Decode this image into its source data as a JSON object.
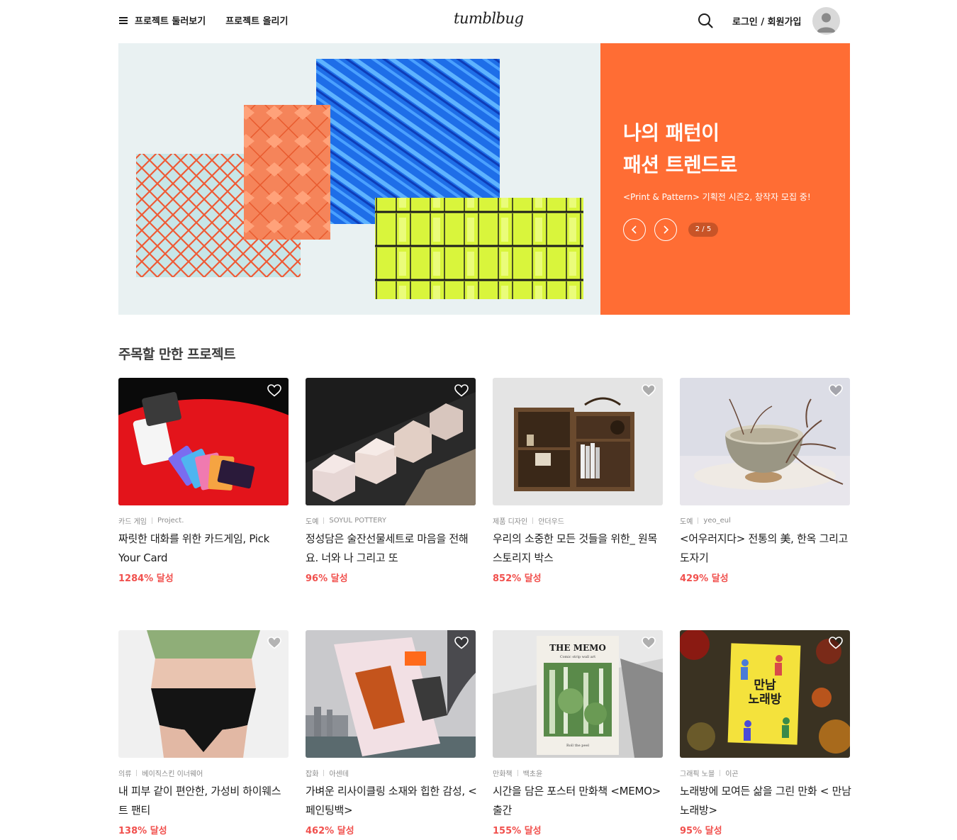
{
  "header": {
    "browse_label": "프로젝트 둘러보기",
    "upload_label": "프로젝트 올리기",
    "logo": "tumblbug",
    "login_label": "로그인 / 회원가입"
  },
  "banner": {
    "title_line1": "나의 패턴이",
    "title_line2": "패션 트렌드로",
    "subtitle": "<Print & Pattern> 기획전 시즌2, 창작자 모집 중!",
    "pager": "2 / 5",
    "panel_color": "#ff6d34"
  },
  "section": {
    "title": "주목할 만한 프로젝트"
  },
  "projects": [
    {
      "category": "카드 게임",
      "creator": "Project.",
      "title": "짜릿한 대화를 위한 카드게임, Pick Your Card",
      "percent": "1284% 달성"
    },
    {
      "category": "도예",
      "creator": "SOYUL POTTERY",
      "title": "정성담은 술잔선물세트로 마음을 전해요. 너와 나 그리고 또",
      "percent": "96% 달성"
    },
    {
      "category": "제품 디자인",
      "creator": "안더우드",
      "title": "우리의 소중한 모든 것들을 위한_ 원목 스토리지 박스",
      "percent": "852% 달성"
    },
    {
      "category": "도예",
      "creator": "yeo_eul",
      "title": "<어우러지다> 전통의 美, 한옥 그리고 도자기",
      "percent": "429% 달성"
    },
    {
      "category": "의류",
      "creator": "베이직스킨 이너웨어",
      "title": "내 피부 같이 편안한, 가성비 하이웨스트 팬티",
      "percent": "138% 달성"
    },
    {
      "category": "잡화",
      "creator": "아센테",
      "title": "가벼운 리사이클링 소재와 힙한 감성, <페인팅백>",
      "percent": "462% 달성"
    },
    {
      "category": "만화책",
      "creator": "백초윤",
      "title": "시간을 담은 포스터 만화책 <MEMO> 출간",
      "percent": "155% 달성",
      "cover_title": "THE MEMO",
      "cover_sub": "Comic strip wall art",
      "cover_foot": "Roll the peel"
    },
    {
      "category": "그래픽 노블",
      "creator": "이곤",
      "title": "노래방에 모여든 삶을 그린 만화 < 만남 노래방>",
      "percent": "95% 달성",
      "cover_title": "만남 노래방"
    }
  ],
  "colors": {
    "accent": "#f1504d",
    "text": "#1d1d1d",
    "muted": "#8b8b8b"
  }
}
